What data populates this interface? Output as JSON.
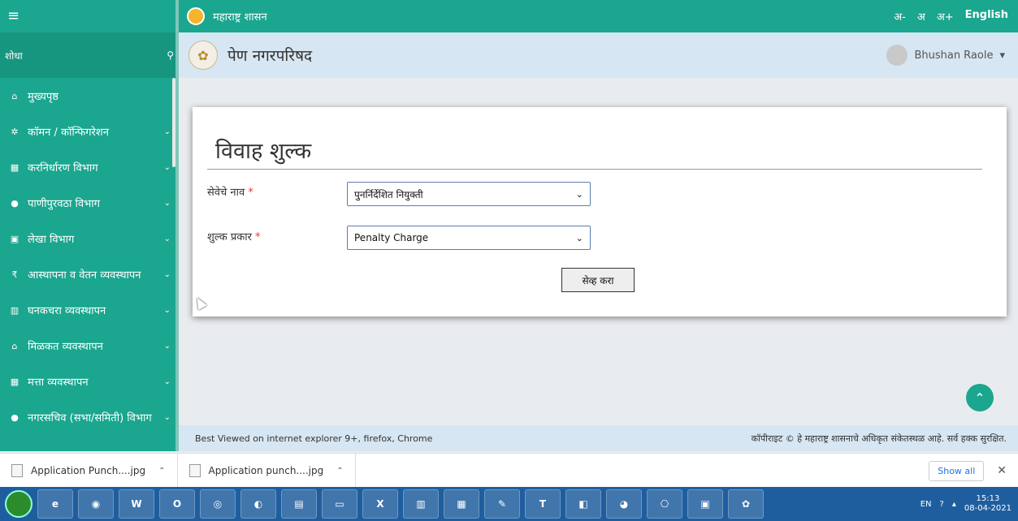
{
  "header": {
    "title": "महाराष्ट्र शासन",
    "font_small": "अ-",
    "font_normal": "अ",
    "font_large": "अ+",
    "language": "English"
  },
  "subheader": {
    "org_name": "पेण नगरपरिषद",
    "user_name": "Bhushan Raole"
  },
  "sidebar": {
    "search_label": "शोधा",
    "items": [
      {
        "label": "मुख्यपृष्ठ",
        "icon": "home-icon",
        "glyph": "⌂",
        "has_chevron": false
      },
      {
        "label": "कॉमन / कॉन्फिगरेशन",
        "icon": "gear-icon",
        "glyph": "✲",
        "has_chevron": true
      },
      {
        "label": "करनिर्धारण विभाग",
        "icon": "building-icon",
        "glyph": "▦",
        "has_chevron": true
      },
      {
        "label": "पाणीपुरवठा विभाग",
        "icon": "water-drop-icon",
        "glyph": "●",
        "has_chevron": true
      },
      {
        "label": "लेखा विभाग",
        "icon": "money-icon",
        "glyph": "▣",
        "has_chevron": true
      },
      {
        "label": "आस्थापना व वेतन व्यवस्थापन",
        "icon": "rupee-icon",
        "glyph": "₹",
        "has_chevron": true
      },
      {
        "label": "घनकचरा व्यवस्थापन",
        "icon": "trash-icon",
        "glyph": "▥",
        "has_chevron": true
      },
      {
        "label": "मिळकत व्यवस्थापन",
        "icon": "home-icon",
        "glyph": "⌂",
        "has_chevron": true
      },
      {
        "label": "मत्ता व्यवस्थापन",
        "icon": "building-icon",
        "glyph": "▦",
        "has_chevron": true
      },
      {
        "label": "नगरसचिव (सभा/समिती) विभाग",
        "icon": "user-icon",
        "glyph": "●",
        "has_chevron": true
      }
    ]
  },
  "form": {
    "title": "विवाह शुल्क",
    "service_label": "सेवेचे नाव",
    "service_value": "पुनर्निर्देशित नियुक्ती",
    "fee_type_label": "शुल्क प्रकार",
    "fee_type_value": "Penalty Charge",
    "required_mark": "*",
    "save_label": "सेव्ह करा"
  },
  "footer": {
    "left": "Best Viewed on internet explorer 9+, firefox, Chrome",
    "right": "कॉपीराइट © हे महाराष्ट्र शासनाचे अधिकृत संकेतस्थळ आहे. सर्व हक्क सुरक्षित."
  },
  "downloads": {
    "files": [
      "Application Punch....jpg",
      "Application punch....jpg"
    ],
    "show_all": "Show all"
  },
  "taskbar": {
    "language": "EN",
    "time": "15:13",
    "date": "08-04-2021"
  },
  "colors": {
    "primary": "#1aa68f",
    "subbar": "#d6e6f2"
  }
}
